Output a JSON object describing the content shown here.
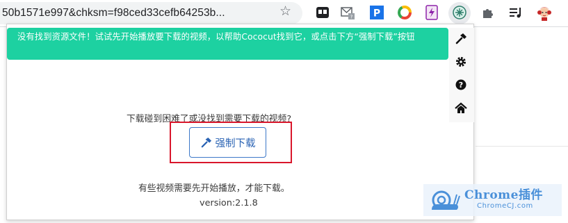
{
  "browser": {
    "url_text": "50b1571e997&chksm=f98ced33cefb64253b...",
    "bookmark_icon": "star-outline-icon",
    "extensions": [
      {
        "name": "tab-manager-extension-icon",
        "color": "#202124"
      },
      {
        "name": "gmail-checker-extension-icon",
        "color": "#5f6368"
      },
      {
        "name": "p-extension-icon",
        "color": "#1a73e8"
      },
      {
        "name": "chrome-ring-extension-icon",
        "color": "#ea4335"
      },
      {
        "name": "lightning-extension-icon",
        "color": "#8e24aa"
      },
      {
        "name": "cococut-extension-icon",
        "color": "#2e7d6b"
      },
      {
        "name": "extensions-puzzle-icon",
        "color": "#5f6368"
      },
      {
        "name": "media-playlist-icon",
        "color": "#202124"
      },
      {
        "name": "profile-avatar-icon",
        "color": "#c62828"
      }
    ]
  },
  "popup": {
    "alert_text": "没有找到资源文件！试试先开始播放要下载的视频，以帮助Cococut找到它，或点击下方“强制下载”按钮",
    "question": "下载碰到困难了或没找到需要下载的视频?",
    "force_button_label": "强制下载",
    "note": "有些视频需要先开始播放，才能下载。",
    "version": "version:2.1.8",
    "side_icons": [
      "hammer-icon",
      "gear-icon",
      "help-icon",
      "home-icon"
    ],
    "colors": {
      "alert_bg": "#1dd1a1",
      "button_border": "#3c78c8",
      "highlight_box": "#d9162b"
    }
  },
  "watermark": {
    "title": "Chrome插件",
    "subtitle": "ChromeCJ.com"
  }
}
